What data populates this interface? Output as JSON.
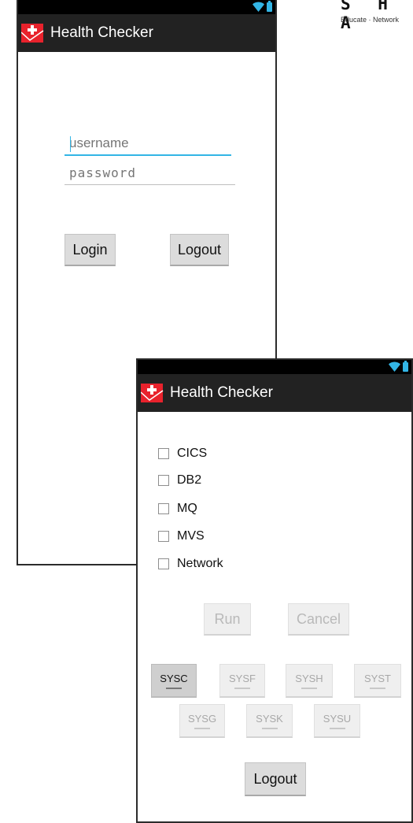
{
  "corner_logo": {
    "letters": "S H A",
    "tagline": "Educate · Network"
  },
  "login_screen": {
    "app_title": "Health Checker",
    "username_placeholder": "username",
    "password_placeholder": "password",
    "login_label": "Login",
    "logout_label": "Logout"
  },
  "checker_screen": {
    "app_title": "Health Checker",
    "checks": [
      "CICS",
      "DB2",
      "MQ",
      "MVS",
      "Network"
    ],
    "run_label": "Run",
    "cancel_label": "Cancel",
    "systems_row1": [
      "SYSC",
      "SYSF",
      "SYSH",
      "SYST"
    ],
    "systems_row2": [
      "SYSG",
      "SYSK",
      "SYSU"
    ],
    "selected_system": "SYSC",
    "logout_label": "Logout"
  },
  "colors": {
    "accent": "#33b5e5",
    "actionbar": "#222222",
    "app_icon_red": "#e8222c"
  }
}
